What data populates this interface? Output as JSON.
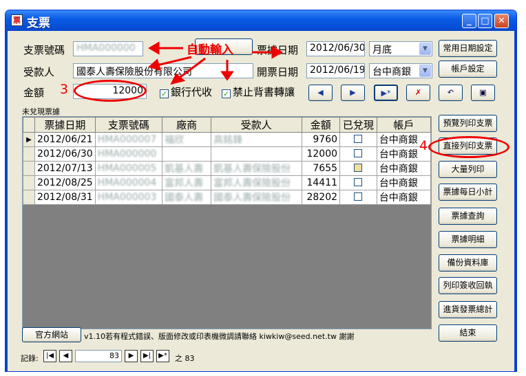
{
  "window": {
    "title": "支票",
    "icon_glyph": "票"
  },
  "form": {
    "check_no_label": "支票號碼",
    "check_no_value": "HMA000000",
    "payee_label": "受款人",
    "payee_value": "國泰人壽保險股份有限公司",
    "amount_label": "金額",
    "amount_value": "12000",
    "receipt_date_label": "票據日期",
    "receipt_date_value": "2012/06/30",
    "receipt_date_combo": "月底",
    "issue_date_label": "開票日期",
    "issue_date_value": "2012/06/19",
    "bank_combo": "台中商銀",
    "bank_collect_label": "銀行代收",
    "no_endorse_label": "禁止背書轉讓"
  },
  "annotations": {
    "auto_input": "自動輸入",
    "step3": "3",
    "step4": "4"
  },
  "buttons": {
    "common_date": "常用日期設定",
    "account_setting": "帳戶設定",
    "preview_print": "預覽列印支票",
    "direct_print": "直接列印支票",
    "bulk_print": "大量列印",
    "daily_subtotal": "票據每日小計",
    "query": "票據查詢",
    "detail": "票據明細",
    "backup": "備份資料庫",
    "print_receipt": "列印簽收回執",
    "purchase_total": "進貨發票總計",
    "exit": "結束",
    "official_site": "官方網站"
  },
  "grid": {
    "caption": "未兌現票據",
    "headers": [
      "票據日期",
      "支票號碼",
      "廠商",
      "受款人",
      "金額",
      "已兌現",
      "帳戶"
    ],
    "rows": [
      {
        "date": "2012/06/21",
        "no": "HMA000007",
        "vendor": "福欣",
        "payee": "高銘鋒",
        "amount": "9760",
        "account": "台中商銀"
      },
      {
        "date": "2012/06/30",
        "no": "HMA000000",
        "vendor": "",
        "payee": "",
        "amount": "12000",
        "account": "台中商銀"
      },
      {
        "date": "2012/07/13",
        "no": "HMA000005",
        "vendor": "凱基人壽",
        "payee": "凱基人壽保險股份",
        "amount": "7655",
        "account": "台中商銀"
      },
      {
        "date": "2012/08/25",
        "no": "HMA000004",
        "vendor": "富邦人壽",
        "payee": "富邦人壽保險股份",
        "amount": "14411",
        "account": "台中商銀"
      },
      {
        "date": "2012/08/31",
        "no": "HMA000003",
        "vendor": "國泰人壽",
        "payee": "國泰人壽保險股份",
        "amount": "28202",
        "account": "台中商銀"
      }
    ]
  },
  "footer": {
    "version_note": "v1.10若有程式錯誤、版面修改或印表機微調請聯絡 kiwkiw@seed.net.tw 謝謝",
    "record_label": "記錄:",
    "record_current": "83",
    "record_of": "之 83"
  }
}
